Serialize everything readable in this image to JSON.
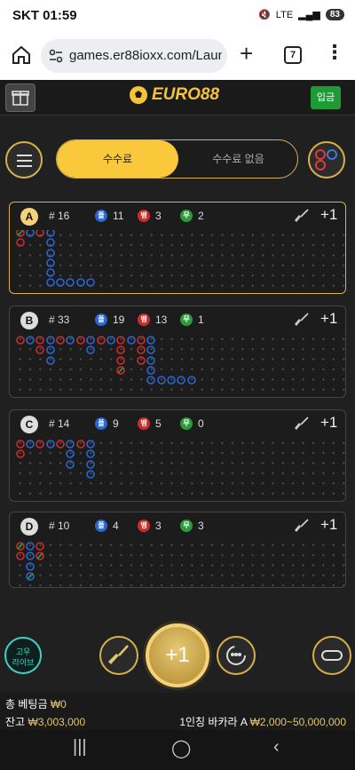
{
  "status": {
    "time": "SKT 01:59",
    "network": "LTE",
    "battery": "83"
  },
  "browser": {
    "url": "games.er88ioxx.com/Launc",
    "tab_count": "7"
  },
  "app": {
    "logo": "EURO88",
    "deposit_label": "입금"
  },
  "toggle": {
    "left_label": "수수료",
    "right_label": "수수료 없음"
  },
  "tables": [
    {
      "letter": "A",
      "count": "# 16",
      "player": "11",
      "banker": "3",
      "tie": "2",
      "plus": "+1"
    },
    {
      "letter": "B",
      "count": "# 33",
      "player": "19",
      "banker": "13",
      "tie": "1",
      "plus": "+1"
    },
    {
      "letter": "C",
      "count": "# 14",
      "player": "9",
      "banker": "5",
      "tie": "0",
      "plus": "+1"
    },
    {
      "letter": "D",
      "count": "# 10",
      "player": "4",
      "banker": "3",
      "tie": "3",
      "plus": "+1"
    }
  ],
  "dot_labels": {
    "player": "플",
    "banker": "뱅",
    "tie": "무"
  },
  "controls": {
    "chat_line1": "고우",
    "chat_line2": "라이브",
    "big_button": "+1"
  },
  "footer": {
    "bet_label": "총 베팅금",
    "bet_value": "₩0",
    "balance_label": "잔고",
    "balance_value": "₩3,003,000",
    "table_label": "1인칭 바카라 A",
    "table_limit": "₩2,000~50,000,000"
  },
  "colors": {
    "gold": "#d8b04a",
    "player": "#2a66d1",
    "banker": "#d12a2a",
    "tie": "#2a9a3a"
  }
}
